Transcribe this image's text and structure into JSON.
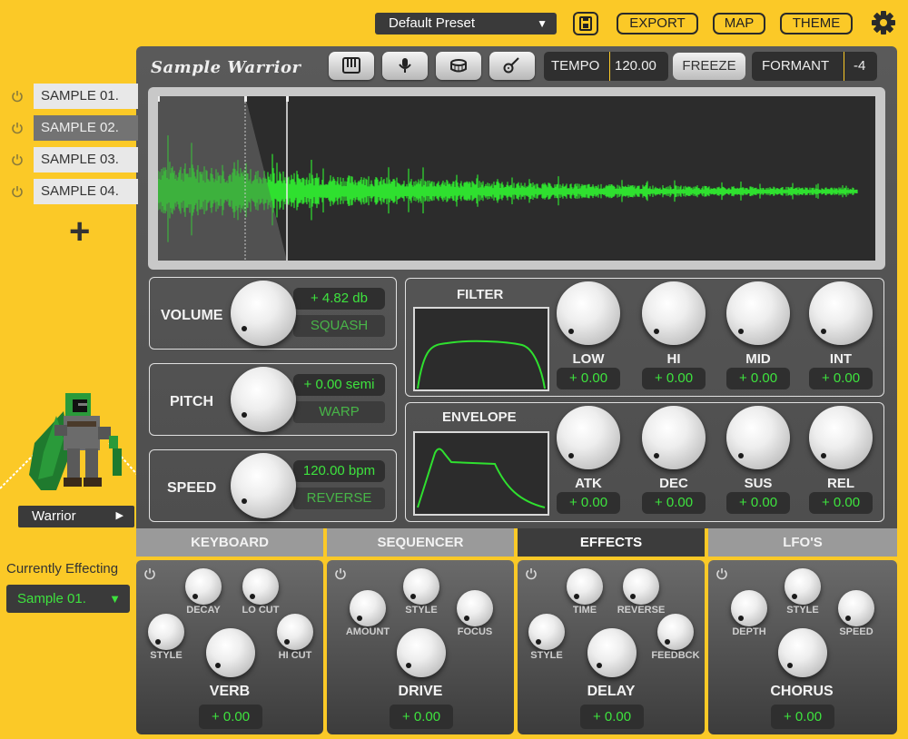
{
  "header": {
    "preset": "Default Preset",
    "export_label": "EXPORT",
    "map_label": "MAP",
    "theme_label": "THEME",
    "icons": [
      "save-icon",
      "gear-icon",
      "chevron-down-icon"
    ]
  },
  "samples": [
    "SAMPLE 01.",
    "SAMPLE 02.",
    "SAMPLE 03.",
    "SAMPLE 04."
  ],
  "active_sample_index": 1,
  "add_label": "+",
  "character": {
    "name": "Warrior"
  },
  "currently_effecting": {
    "label": "Currently Effecting",
    "value": "Sample 01."
  },
  "instrument": {
    "logo": "Sample Warrior",
    "mode_icons": [
      "piano-icon",
      "microphone-icon",
      "drum-icon",
      "guitar-icon"
    ],
    "tempo_label": "TEMPO",
    "tempo_value": "120.00",
    "freeze_label": "FREEZE",
    "formant_label": "FORMANT",
    "formant_value": "-4"
  },
  "colors": {
    "accent": "#fbc927",
    "waveform": "#2fe02f",
    "value_text": "#3ee33e",
    "panel": "#555555"
  },
  "controls": {
    "volume": {
      "label": "VOLUME",
      "value": "+ 4.82 db",
      "option": "SQUASH"
    },
    "pitch": {
      "label": "PITCH",
      "value": "+ 0.00 semi",
      "option": "WARP"
    },
    "speed": {
      "label": "SPEED",
      "value": "120.00 bpm",
      "option": "REVERSE"
    }
  },
  "filter": {
    "title": "FILTER",
    "knobs": [
      {
        "label": "LOW",
        "value": "+ 0.00"
      },
      {
        "label": "HI",
        "value": "+ 0.00"
      },
      {
        "label": "MID",
        "value": "+ 0.00"
      },
      {
        "label": "INT",
        "value": "+ 0.00"
      }
    ]
  },
  "envelope": {
    "title": "ENVELOPE",
    "knobs": [
      {
        "label": "ATK",
        "value": "+ 0.00"
      },
      {
        "label": "DEC",
        "value": "+ 0.00"
      },
      {
        "label": "SUS",
        "value": "+ 0.00"
      },
      {
        "label": "REL",
        "value": "+ 0.00"
      }
    ]
  },
  "tabs": [
    "KEYBOARD",
    "SEQUENCER",
    "EFFECTS",
    "LFO'S"
  ],
  "active_tab_index": 2,
  "effects": [
    {
      "title": "VERB",
      "value": "+ 0.00",
      "labels": [
        "DECAY",
        "LO CUT",
        "STYLE",
        "HI CUT"
      ]
    },
    {
      "title": "DRIVE",
      "value": "+ 0.00",
      "labels": [
        "STYLE",
        "AMOUNT",
        "FOCUS"
      ]
    },
    {
      "title": "DELAY",
      "value": "+ 0.00",
      "labels": [
        "TIME",
        "REVERSE",
        "STYLE",
        "FEEDBCK"
      ]
    },
    {
      "title": "CHORUS",
      "value": "+ 0.00",
      "labels": [
        "STYLE",
        "DEPTH",
        "SPEED"
      ]
    }
  ]
}
